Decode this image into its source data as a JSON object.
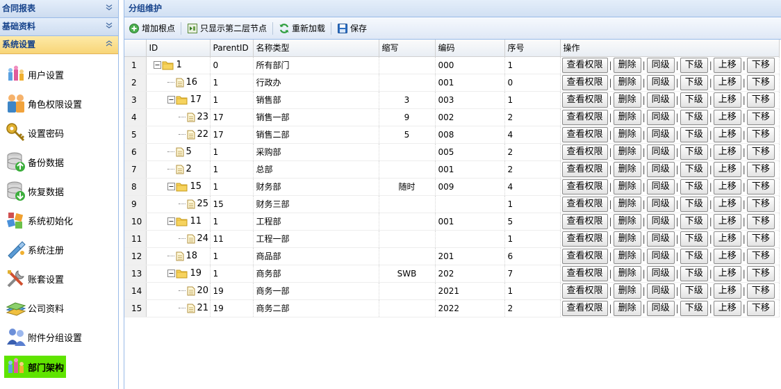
{
  "sidebar": {
    "headers": [
      {
        "label": "合同报表",
        "active": false
      },
      {
        "label": "基础资料",
        "active": false
      },
      {
        "label": "系统设置",
        "active": true
      }
    ],
    "items": [
      {
        "label": "用户设置",
        "icon": "users-icon"
      },
      {
        "label": "角色权限设置",
        "icon": "roles-icon"
      },
      {
        "label": "设置密码",
        "icon": "key-icon"
      },
      {
        "label": "备份数据",
        "icon": "database-backup-icon"
      },
      {
        "label": "恢复数据",
        "icon": "database-restore-icon"
      },
      {
        "label": "系统初始化",
        "icon": "cubes-icon"
      },
      {
        "label": "系统注册",
        "icon": "register-icon"
      },
      {
        "label": "账套设置",
        "icon": "tools-icon"
      },
      {
        "label": "公司资料",
        "icon": "books-icon"
      },
      {
        "label": "附件分组设置",
        "icon": "group-icon"
      },
      {
        "label": "部门架构",
        "icon": "org-icon",
        "selected": true
      }
    ]
  },
  "main": {
    "title": "分组维护",
    "toolbar": {
      "add_root": "增加根点",
      "show_second": "只显示第二层节点",
      "reload": "重新加载",
      "save": "保存"
    },
    "columns": {
      "id": "ID",
      "parent_id": "ParentID",
      "name": "名称类型",
      "abbr": "缩写",
      "code": "编码",
      "order": "序号",
      "ops": "操作"
    },
    "op_labels": {
      "view": "查看权限",
      "delete": "删除",
      "same": "同级",
      "child": "下级",
      "up": "上移",
      "down": "下移"
    },
    "rows": [
      {
        "rn": "1",
        "id": "1",
        "pid": "0",
        "name": "所有部门",
        "abbr": "",
        "code": "000",
        "order": "1",
        "level": 0,
        "folder": true
      },
      {
        "rn": "2",
        "id": "16",
        "pid": "1",
        "name": "行政办",
        "abbr": "",
        "code": "001",
        "order": "0",
        "level": 1,
        "folder": false
      },
      {
        "rn": "3",
        "id": "17",
        "pid": "1",
        "name": "销售部",
        "abbr": "3",
        "code": "003",
        "order": "1",
        "level": 1,
        "folder": true
      },
      {
        "rn": "4",
        "id": "23",
        "pid": "17",
        "name": "销售一部",
        "abbr": "9",
        "code": "002",
        "order": "2",
        "level": 2,
        "folder": false
      },
      {
        "rn": "5",
        "id": "22",
        "pid": "17",
        "name": "销售二部",
        "abbr": "5",
        "code": "008",
        "order": "4",
        "level": 2,
        "folder": false
      },
      {
        "rn": "6",
        "id": "5",
        "pid": "1",
        "name": "采购部",
        "abbr": "",
        "code": "005",
        "order": "2",
        "level": 1,
        "folder": false
      },
      {
        "rn": "7",
        "id": "2",
        "pid": "1",
        "name": "总部",
        "abbr": "",
        "code": "001",
        "order": "2",
        "level": 1,
        "folder": false
      },
      {
        "rn": "8",
        "id": "15",
        "pid": "1",
        "name": "财务部",
        "abbr": "随时",
        "code": "009",
        "order": "4",
        "level": 1,
        "folder": true
      },
      {
        "rn": "9",
        "id": "25",
        "pid": "15",
        "name": "财务三部",
        "abbr": "",
        "code": "",
        "order": "1",
        "level": 2,
        "folder": false
      },
      {
        "rn": "10",
        "id": "11",
        "pid": "1",
        "name": "工程部",
        "abbr": "",
        "code": "001",
        "order": "5",
        "level": 1,
        "folder": true
      },
      {
        "rn": "11",
        "id": "24",
        "pid": "11",
        "name": "工程一部",
        "abbr": "",
        "code": "",
        "order": "1",
        "level": 2,
        "folder": false
      },
      {
        "rn": "12",
        "id": "18",
        "pid": "1",
        "name": "商品部",
        "abbr": "",
        "code": "201",
        "order": "6",
        "level": 1,
        "folder": false
      },
      {
        "rn": "13",
        "id": "19",
        "pid": "1",
        "name": "商务部",
        "abbr": "SWB",
        "code": "202",
        "order": "7",
        "level": 1,
        "folder": true
      },
      {
        "rn": "14",
        "id": "20",
        "pid": "19",
        "name": "商务一部",
        "abbr": "",
        "code": "2021",
        "order": "1",
        "level": 2,
        "folder": false
      },
      {
        "rn": "15",
        "id": "21",
        "pid": "19",
        "name": "商务二部",
        "abbr": "",
        "code": "2022",
        "order": "2",
        "level": 2,
        "folder": false
      }
    ]
  },
  "colors": {
    "header_blue": "#15428b",
    "border_blue": "#99bbe8",
    "selected_green": "#5fe400",
    "active_header": "#f8d577"
  }
}
